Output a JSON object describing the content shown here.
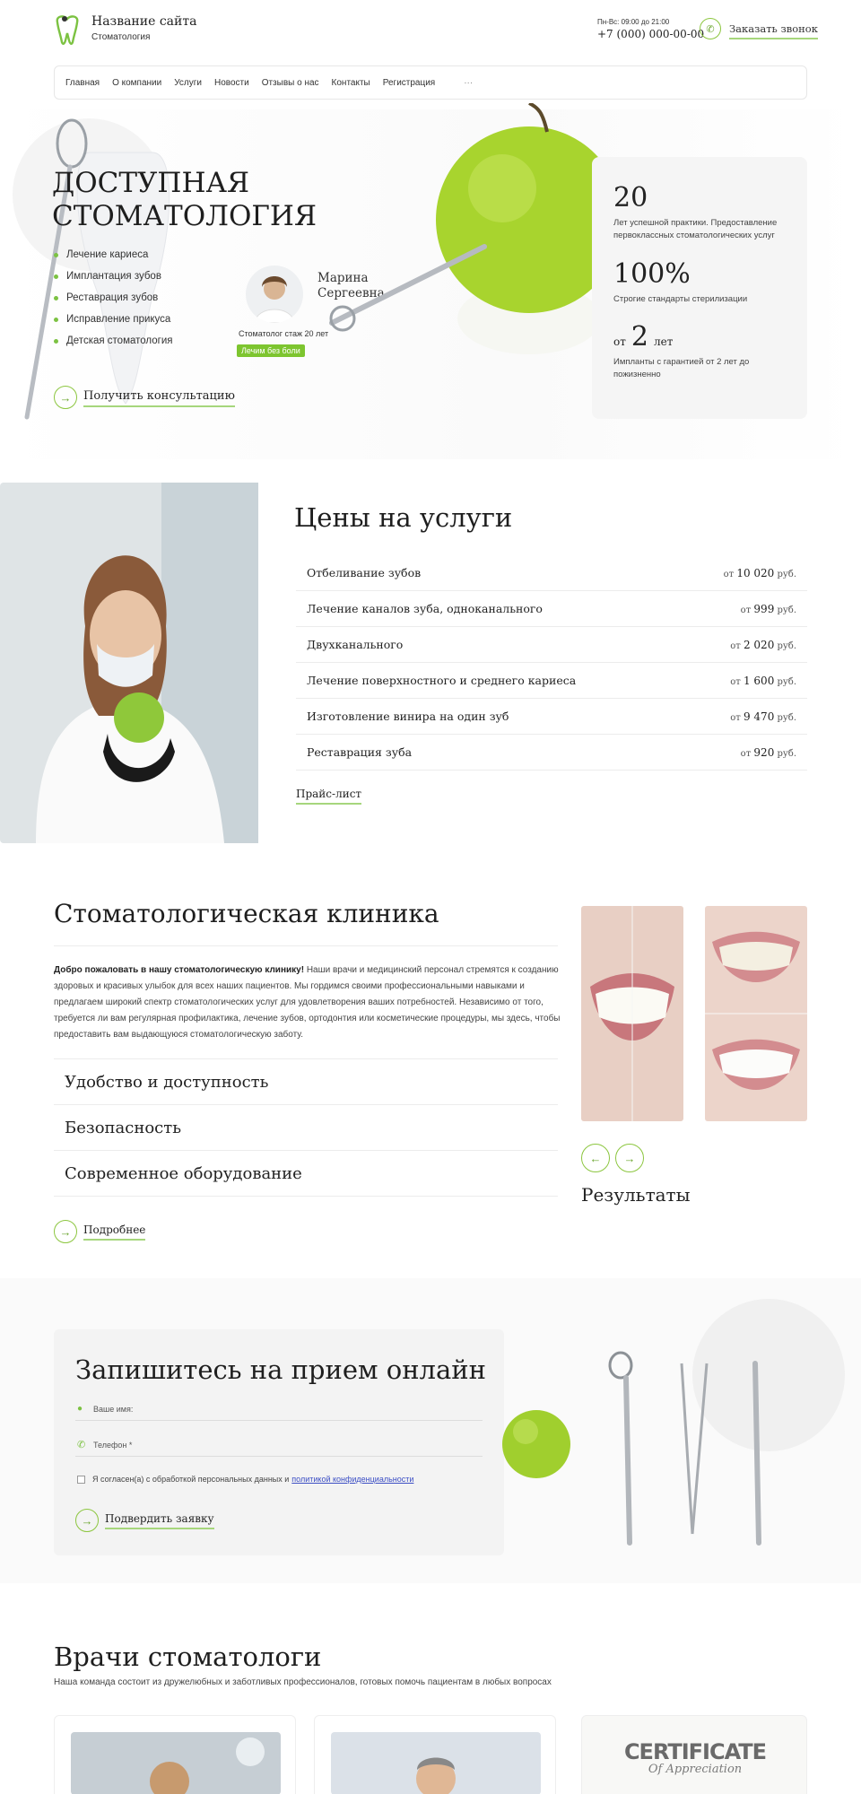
{
  "header": {
    "site_name": "Название сайта",
    "site_sub": "Стоматология",
    "hours": "Пн-Вс: 09:00 до 21:00",
    "phone": "+7 (000) 000-00-00",
    "callback_label": "Заказать звонок"
  },
  "nav": {
    "items": [
      "Главная",
      "О компании",
      "Услуги",
      "Новости",
      "Отзывы о нас",
      "Контакты",
      "Регистрация"
    ],
    "more": "···"
  },
  "hero": {
    "title_line1": "ДОСТУПНАЯ",
    "title_line2": "СТОМАТОЛОГИЯ",
    "services": [
      "Лечение кариеса",
      "Имплантация зубов",
      "Реставрация зубов",
      "Исправление прикуса",
      "Детская стоматология"
    ],
    "cta_label": "Получить консультацию",
    "doctor_name_1": "Марина",
    "doctor_name_2": "Сергеевна",
    "doctor_role": "Стоматолог  стаж 20 лет",
    "doctor_badge": "Лечим без боли"
  },
  "stats": [
    {
      "num": "20",
      "text": "Лет успешной практики. Предоставление первоклассных стоматологических услуг"
    },
    {
      "num": "100%",
      "text": "Строгие стандарты стерилизации"
    },
    {
      "prefix": "от",
      "num": "2",
      "suffix": "лет",
      "text": "Импланты с гарантией от 2 лет до пожизненно"
    }
  ],
  "prices": {
    "title": "Цены на услуги",
    "rows": [
      {
        "name": "Отбеливание зубов",
        "from": "от",
        "value": "10 020",
        "unit": "руб."
      },
      {
        "name": "Лечение каналов зуба, одноканального",
        "from": "от",
        "value": "999",
        "unit": "руб."
      },
      {
        "name": "Двухканального",
        "from": "от",
        "value": "2 020",
        "unit": "руб."
      },
      {
        "name": "Лечение поверхностного и среднего кариеса",
        "from": "от",
        "value": "1 600",
        "unit": "руб."
      },
      {
        "name": "Изготовление винира на один зуб",
        "from": "от",
        "value": "9 470",
        "unit": "руб."
      },
      {
        "name": "Реставрация зуба",
        "from": "от",
        "value": "920",
        "unit": "руб."
      }
    ],
    "pricelist_label": "Прайс-лист"
  },
  "clinic": {
    "title": "Стоматологическая клиника",
    "intro_bold": "Добро пожаловать в нашу стоматологическую клинику!",
    "intro_text": " Наши врачи и медицинский персонал стремятся к созданию здоровых и красивых улыбок для всех наших пациентов. Мы гордимся своими профессиональными навыками и предлагаем широкий спектр стоматологических услуг для удовлетворения ваших потребностей. Независимо от того, требуется ли вам регулярная профилактика, лечение зубов, ортодонтия или косметические процедуры, мы здесь, чтобы предоставить вам выдающуюся стоматологическую заботу.",
    "features": [
      "Удобство и доступность",
      "Безопасность",
      "Современное оборудование"
    ],
    "more_label": "Подробнее",
    "results_label": "Результаты"
  },
  "form": {
    "title": "Запишитесь на прием онлайн",
    "name_placeholder": "Ваше имя:",
    "phone_placeholder": "Телефон *",
    "consent_text": "Я согласен(а) с обработкой персональных данных и ",
    "consent_link": "политикой конфиденциальности",
    "submit_label": "Подвердить заявку"
  },
  "doctors": {
    "title": "Врачи стоматологи",
    "subtitle": "Наша команда состоит из дружелюбных и заботливых профессионалов, готовых помочь пациентам в любых вопросах",
    "certificate_line1": "CERTIFICATE",
    "certificate_line2": "Of Appreciation"
  },
  "colors": {
    "accent": "#7cc242",
    "badge": "#7dc52f",
    "light_bg": "#f5f5f5"
  }
}
